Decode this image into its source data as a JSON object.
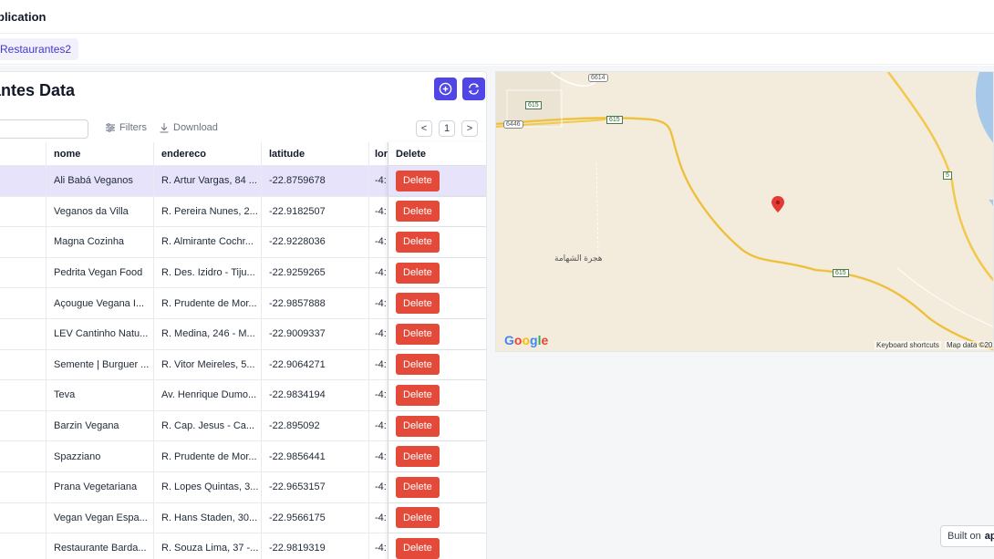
{
  "app": {
    "title": "plication"
  },
  "tabs": [
    {
      "label": "Restaurantes2"
    }
  ],
  "panel": {
    "title": "antes Data",
    "search_value": "",
    "filters_label": "Filters",
    "download_label": "Download",
    "page_number": "1",
    "pager_prev": "<",
    "pager_next": ">"
  },
  "table": {
    "columns": [
      "",
      "nome",
      "endereco",
      "latitude",
      "lor",
      "Delete"
    ],
    "rows": [
      {
        "nome": "Ali Babá Veganos",
        "endereco": "R. Artur Vargas, 84 ...",
        "latitude": "-22.8759678",
        "lon": "-4:",
        "selected": true
      },
      {
        "nome": "Veganos da Villa",
        "endereco": "R. Pereira Nunes, 2...",
        "latitude": "-22.9182507",
        "lon": "-4:"
      },
      {
        "nome": "Magna Cozinha",
        "endereco": "R. Almirante Cochr...",
        "latitude": "-22.9228036",
        "lon": "-4:"
      },
      {
        "nome": "Pedrita Vegan Food",
        "endereco": "R. Des. Izidro - Tiju...",
        "latitude": "-22.9259265",
        "lon": "-4:"
      },
      {
        "nome": "Açougue Vegana I...",
        "endereco": "R. Prudente de Mor...",
        "latitude": "-22.9857888",
        "lon": "-4:"
      },
      {
        "nome": "LEV Cantinho Natu...",
        "endereco": "R. Medina, 246 - M...",
        "latitude": "-22.9009337",
        "lon": "-4:"
      },
      {
        "nome": "Semente | Burguer ...",
        "endereco": "R. Vitor Meireles, 5...",
        "latitude": "-22.9064271",
        "lon": "-4:"
      },
      {
        "nome": "Teva",
        "endereco": "Av. Henrique Dumo...",
        "latitude": "-22.9834194",
        "lon": "-4:"
      },
      {
        "nome": "Barzin Vegana",
        "endereco": "R. Cap. Jesus - Ca...",
        "latitude": "-22.895092",
        "lon": "-4:"
      },
      {
        "nome": "Spazziano",
        "endereco": "R. Prudente de Mor...",
        "latitude": "-22.9856441",
        "lon": "-4:"
      },
      {
        "nome": "Prana Vegetariana",
        "endereco": "R. Lopes Quintas, 3...",
        "latitude": "-22.9653157",
        "lon": "-4:"
      },
      {
        "nome": "Vegan Vegan Espa...",
        "endereco": "R. Hans Staden, 30...",
        "latitude": "-22.9566175",
        "lon": "-4:"
      },
      {
        "nome": "Restaurante Barda...",
        "endereco": "R. Souza Lima, 37 -...",
        "latitude": "-22.9819319",
        "lon": "-4:"
      }
    ],
    "delete_label": "Delete"
  },
  "map": {
    "place_label": "هجرة الشهامة",
    "road_labels": [
      "6614",
      "615",
      "6446",
      "615",
      "5",
      "615"
    ],
    "google_logo": "Google",
    "keyboard_shortcuts": "Keyboard shortcuts",
    "map_data": "Map data ©202",
    "marker_color": "#e53935"
  },
  "footer": {
    "built_on_label": "Built on",
    "built_on_brand": "ap"
  },
  "colors": {
    "accent": "#4f46e5",
    "danger": "#e34a3a",
    "selected_row": "#e6e3fb"
  }
}
